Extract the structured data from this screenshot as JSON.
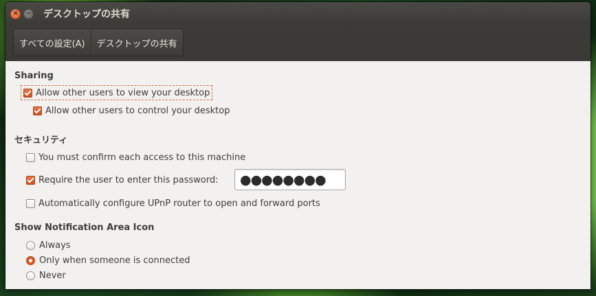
{
  "window": {
    "title": "デスクトップの共有",
    "close_glyph": "×",
    "minimize_glyph": "−",
    "accent_color": "#dd4814",
    "titlebar_color": "#3c3b37",
    "content_background": "#f2f1f0"
  },
  "toolbar": {
    "breadcrumbs": [
      {
        "label": "すべての設定(A)"
      },
      {
        "label": "デスクトップの共有"
      }
    ]
  },
  "sharing": {
    "title": "Sharing",
    "allow_view": {
      "label": "Allow other users to view your desktop",
      "checked": true
    },
    "allow_control": {
      "label": "Allow other users to control your desktop",
      "checked": true
    }
  },
  "security": {
    "title": "セキュリティ",
    "confirm_access": {
      "label": "You must confirm each access to this machine",
      "checked": false
    },
    "require_password": {
      "label": "Require the user to enter this password:",
      "checked": true
    },
    "password_value": "●●●●●●●●",
    "upnp": {
      "label": "Automatically configure UPnP router to open and forward ports",
      "checked": false
    }
  },
  "notification": {
    "title": "Show Notification Area Icon",
    "options": [
      {
        "label": "Always",
        "selected": false
      },
      {
        "label": "Only when someone is connected",
        "selected": true
      },
      {
        "label": "Never",
        "selected": false
      }
    ]
  },
  "icons": {
    "close": "close-icon",
    "minimize": "minimize-icon",
    "checkbox_checked": "checkbox-checked-icon",
    "checkbox_unchecked": "checkbox-unchecked-icon",
    "radio_selected": "radio-selected-icon",
    "radio_unselected": "radio-unselected-icon"
  }
}
